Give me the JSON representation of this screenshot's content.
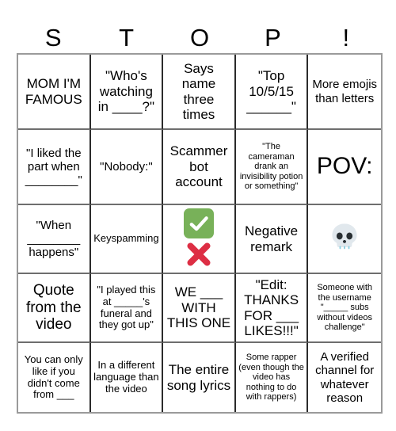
{
  "card": {
    "header_letters": [
      "S",
      "T",
      "O",
      "P",
      "!"
    ],
    "colors": {
      "grid_outer_border": "#9a9a9a",
      "grid_inner_border": "#2b2b2b",
      "background": "#ffffff",
      "text": "#000000",
      "check_green": "#78b159",
      "cross_red": "#dd2e44",
      "skull_bone": "#e1e8ed"
    },
    "rows": [
      [
        {
          "text": "MOM I'M FAMOUS",
          "size": "fs-lg",
          "icon": null
        },
        {
          "text": "\"Who's watching in ____?\"",
          "size": "fs-lg",
          "icon": null
        },
        {
          "text": "Says name three times",
          "size": "fs-lg",
          "icon": null
        },
        {
          "text": "\"Top 10/5/15 ______\"",
          "size": "fs-lg",
          "icon": null
        },
        {
          "text": "More emojis than letters",
          "size": "fs-md",
          "icon": null
        }
      ],
      [
        {
          "text": "\"I liked the part when ________\"",
          "size": "fs-md",
          "icon": null
        },
        {
          "text": "\"Nobody:\"",
          "size": "fs-md",
          "icon": null
        },
        {
          "text": "Scammer bot account",
          "size": "fs-lg",
          "icon": null
        },
        {
          "text": "\"The cameraman drank an invisibility potion or something\"",
          "size": "fs-xs",
          "icon": null
        },
        {
          "text": "POV:",
          "size": "fs-pov",
          "icon": null
        }
      ],
      [
        {
          "text": "\"When ________ happens\"",
          "size": "fs-md",
          "icon": null
        },
        {
          "text": "Keyspamming",
          "size": "fs-sm",
          "icon": null
        },
        {
          "text": "",
          "size": "fs-md",
          "icon": "check-and-cross"
        },
        {
          "text": "Negative remark",
          "size": "fs-lg",
          "icon": null
        },
        {
          "text": "",
          "size": "fs-md",
          "icon": "skull"
        }
      ],
      [
        {
          "text": "Quote from the video",
          "size": "fs-xl",
          "icon": null
        },
        {
          "text": "\"I played this at _____'s funeral and they got up\"",
          "size": "fs-sm",
          "icon": null
        },
        {
          "text": "WE ___ WITH THIS ONE",
          "size": "fs-lg",
          "icon": null
        },
        {
          "text": "\"Edit: THANKS FOR ___ LIKES!!!\"",
          "size": "fs-lg",
          "icon": null
        },
        {
          "text": "Someone with the username \"_____ subs without videos challenge\"",
          "size": "fs-xs",
          "icon": null
        }
      ],
      [
        {
          "text": "You can only like if you didn't come from ___",
          "size": "fs-sm",
          "icon": null
        },
        {
          "text": "In a different language than the video",
          "size": "fs-sm",
          "icon": null
        },
        {
          "text": "The entire song lyrics",
          "size": "fs-lg",
          "icon": null
        },
        {
          "text": "Some rapper (even though the video has nothing to do with rappers)",
          "size": "fs-xs",
          "icon": null
        },
        {
          "text": "A verified channel for whatever reason",
          "size": "fs-md",
          "icon": null
        }
      ]
    ]
  }
}
